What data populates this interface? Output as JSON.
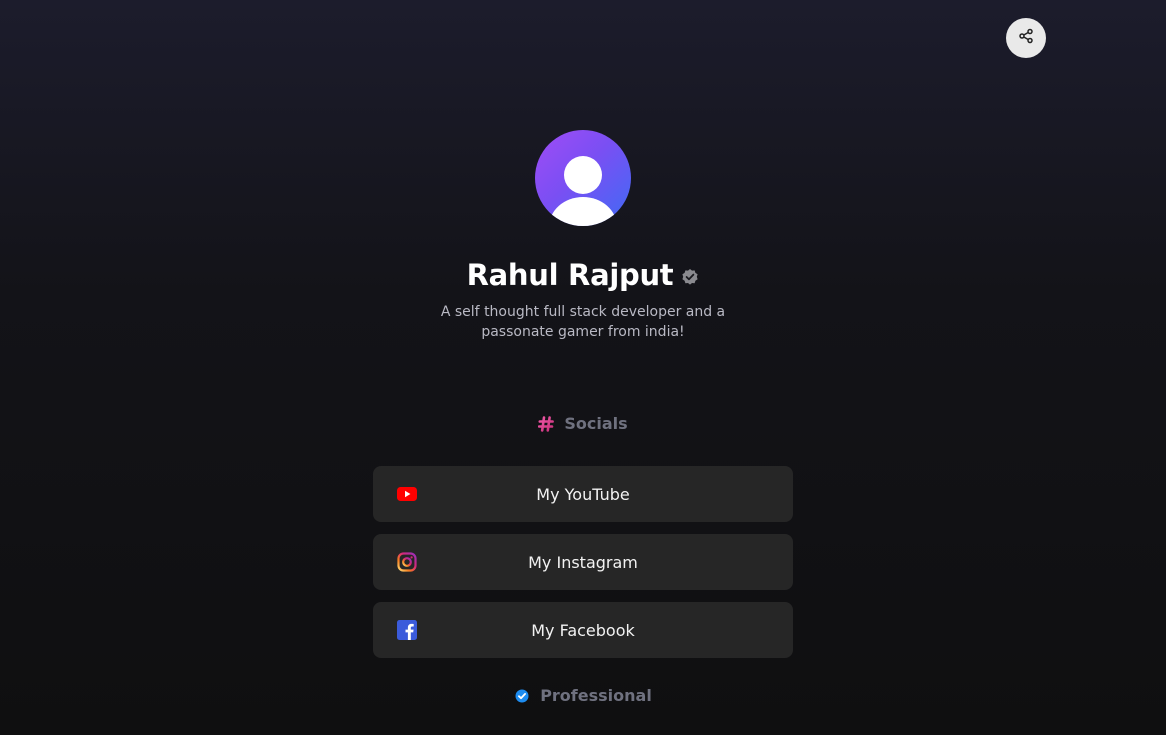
{
  "header": {
    "share_icon": "share-icon"
  },
  "profile": {
    "avatar_icon": "user-avatar-icon",
    "name": "Rahul Rajput",
    "verified_icon": "verified-badge-icon",
    "bio": "A self thought full stack developer and a passonate gamer from india!"
  },
  "sections": {
    "socials": {
      "title": "Socials",
      "icon": "hashtag-icon",
      "icon_color": "#e0429c",
      "links": [
        {
          "label": "My YouTube",
          "icon": "youtube-icon",
          "color": "#ff0000"
        },
        {
          "label": "My Instagram",
          "icon": "instagram-icon",
          "color": "#d62976"
        },
        {
          "label": "My Facebook",
          "icon": "facebook-icon",
          "color": "#3b5bdb"
        }
      ]
    },
    "professional": {
      "title": "Professional",
      "icon": "check-circle-icon",
      "icon_color": "#1d8cf0"
    }
  },
  "colors": {
    "avatar_gradient_start": "#a04cf6",
    "avatar_gradient_end": "#3f6bf5",
    "link_background": "#262626",
    "section_title": "#6f717f"
  }
}
